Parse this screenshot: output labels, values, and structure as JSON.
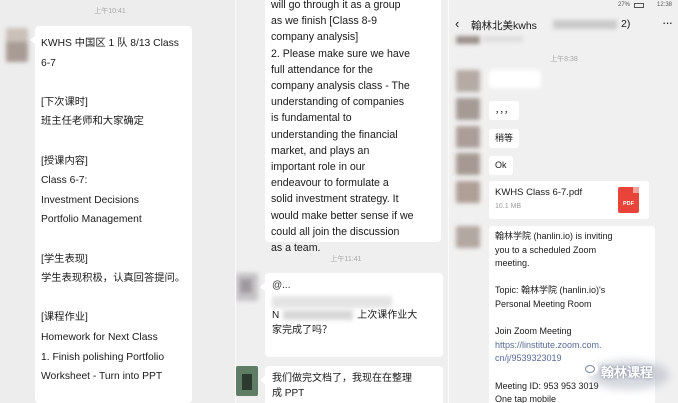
{
  "left": {
    "time": "上午10:41",
    "message_lines": [
      "KWHS 中国区 1 队 8/13 Class",
      "6-7",
      "",
      "[下次课时]",
      "班主任老师和大家确定",
      "",
      "[授课内容]",
      "Class 6-7:",
      "Investment Decisions",
      "Portfolio Management",
      "",
      "[学生表现]",
      "学生表现积极，认真回答提问。",
      "",
      "[课程作业]",
      "Homework for Next Class",
      "1. Finish polishing Portfolio",
      "Worksheet - Turn into PPT"
    ]
  },
  "middle": {
    "message1_lines": [
      "will go through it as a group",
      "as we finish [Class 8-9",
      "company analysis]",
      "2. Please make sure we have",
      "full attendance for the",
      "company analysis class - The",
      "understanding of companies",
      "is fundamental to",
      "understanding the financial",
      "market, and plays an",
      "important role in our",
      "endeavour to formulate a",
      "solid investment strategy. It",
      "would make better sense if we",
      "could all join the discussion",
      "as a team."
    ],
    "time": "上午11:41",
    "message2_line1": "@...",
    "message2_line3_prefix": "N",
    "message2_line3_suffix": "上次课作业大",
    "message2_line4": "家完成了吗？",
    "message3_lines": [
      "我们做完文档了，我现在在整理",
      "成 PPT"
    ]
  },
  "right": {
    "status": {
      "battery": "27%",
      "time": "12:38"
    },
    "title": "翰林北美kwhs",
    "title_suffix": "2)",
    "time": "上午8:38",
    "msg_commas": "，，，",
    "msg_wait": "稍等",
    "msg_ok": "Ok",
    "file": {
      "name": "KWHS Class 6-7.pdf",
      "size": "10.1 MB",
      "icon_label": "PDF"
    },
    "zoom_lines": [
      "翰林学院 (hanlin.io) is inviting",
      "you to a scheduled Zoom",
      "meeting.",
      "",
      "Topic: 翰林学院 (hanlin.io)'s",
      "Personal Meeting Room",
      "",
      "Join Zoom Meeting"
    ],
    "zoom_link_lines": [
      "https://linstitute.zoom.com.",
      "cn/j/9539323019"
    ],
    "zoom_meeting_id": "Meeting ID: 953 953 3019",
    "zoom_last_line": "One tap mobile",
    "watermark": "翰林课程"
  },
  "colors": {
    "bubble": "#ffffff",
    "link": "#576b95",
    "pdf": "#e8443a",
    "bg": "#ededed"
  }
}
